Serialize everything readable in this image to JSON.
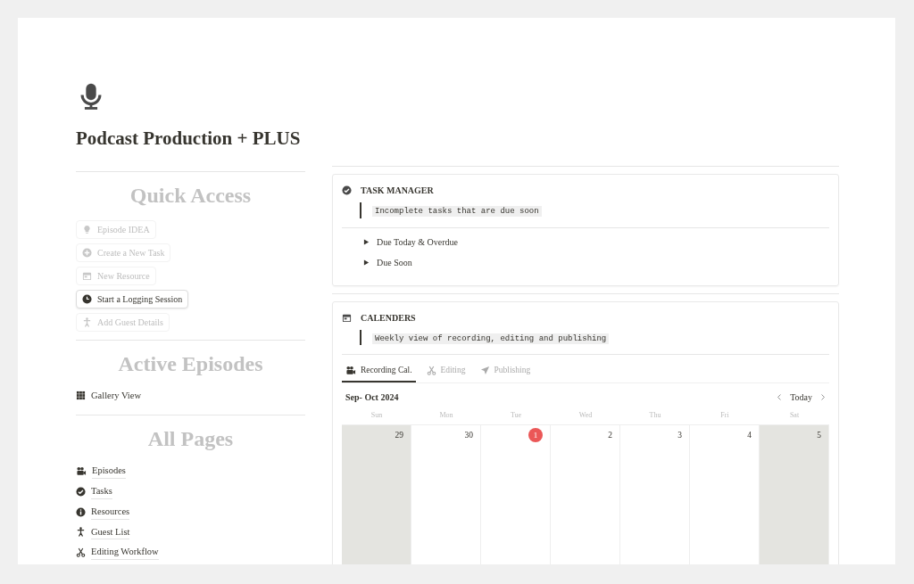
{
  "page": {
    "title": "Podcast Production + PLUS"
  },
  "quick_access": {
    "heading": "Quick Access",
    "items": [
      {
        "label": "Episode IDEA",
        "disabled": true
      },
      {
        "label": "Create a New Task",
        "disabled": true
      },
      {
        "label": "New Resource",
        "disabled": true
      },
      {
        "label": "Start a Logging Session",
        "disabled": false
      },
      {
        "label": "Add Guest Details",
        "disabled": true
      }
    ]
  },
  "active_episodes": {
    "heading": "Active Episodes",
    "view": "Gallery View"
  },
  "all_pages": {
    "heading": "All Pages",
    "items": [
      "Episodes",
      "Tasks",
      "Resources",
      "Guest List",
      "Editing Workflow"
    ]
  },
  "task_manager": {
    "title": "TASK MANAGER",
    "note": "Incomplete tasks that are due soon",
    "toggles": [
      {
        "label": "Due Today & Overdue",
        "expanded": false
      },
      {
        "label": "Due Soon",
        "expanded": false
      }
    ]
  },
  "calendars": {
    "title": "CALENDERS",
    "note": "Weekly view of recording, editing and publishing",
    "tabs": [
      {
        "label": "Recording Cal.",
        "selected": true
      },
      {
        "label": "Editing",
        "selected": false
      },
      {
        "label": "Publishing",
        "selected": false
      }
    ],
    "month": "Sep- Oct 2024",
    "today_button": "Today",
    "weekdays": [
      "Sun",
      "Mon",
      "Tue",
      "Wed",
      "Thu",
      "Fri",
      "Sat"
    ],
    "days": [
      {
        "date": "29",
        "weekend": true,
        "today": false
      },
      {
        "date": "30",
        "weekend": false,
        "today": false
      },
      {
        "date": "1",
        "weekend": false,
        "today": true
      },
      {
        "date": "2",
        "weekend": false,
        "today": false
      },
      {
        "date": "3",
        "weekend": false,
        "today": false
      },
      {
        "date": "4",
        "weekend": false,
        "today": false
      },
      {
        "date": "5",
        "weekend": true,
        "today": false
      }
    ]
  }
}
